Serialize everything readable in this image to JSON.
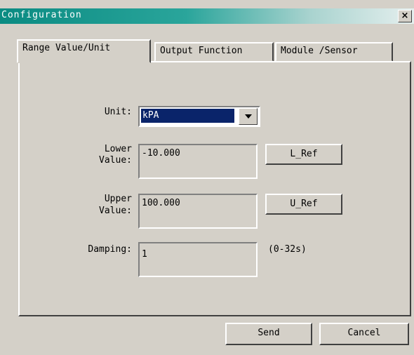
{
  "window": {
    "title": "Configuration",
    "close": "×"
  },
  "tabs": [
    {
      "label": "Range Value/Unit"
    },
    {
      "label": "Output Function"
    },
    {
      "label": "Module /Sensor"
    }
  ],
  "form": {
    "unit_label": "Unit:",
    "unit_value": "kPA",
    "lower_label_1": "Lower",
    "lower_label_2": "Value:",
    "lower_value": "-10.000",
    "lref_label": "L_Ref",
    "upper_label_1": "Upper",
    "upper_label_2": "Value:",
    "upper_value": "100.000",
    "uref_label": "U_Ref",
    "damping_label": "Damping:",
    "damping_value": "1",
    "damping_range": "(0-32s)"
  },
  "footer": {
    "send_label": "Send",
    "cancel_label": "Cancel"
  }
}
